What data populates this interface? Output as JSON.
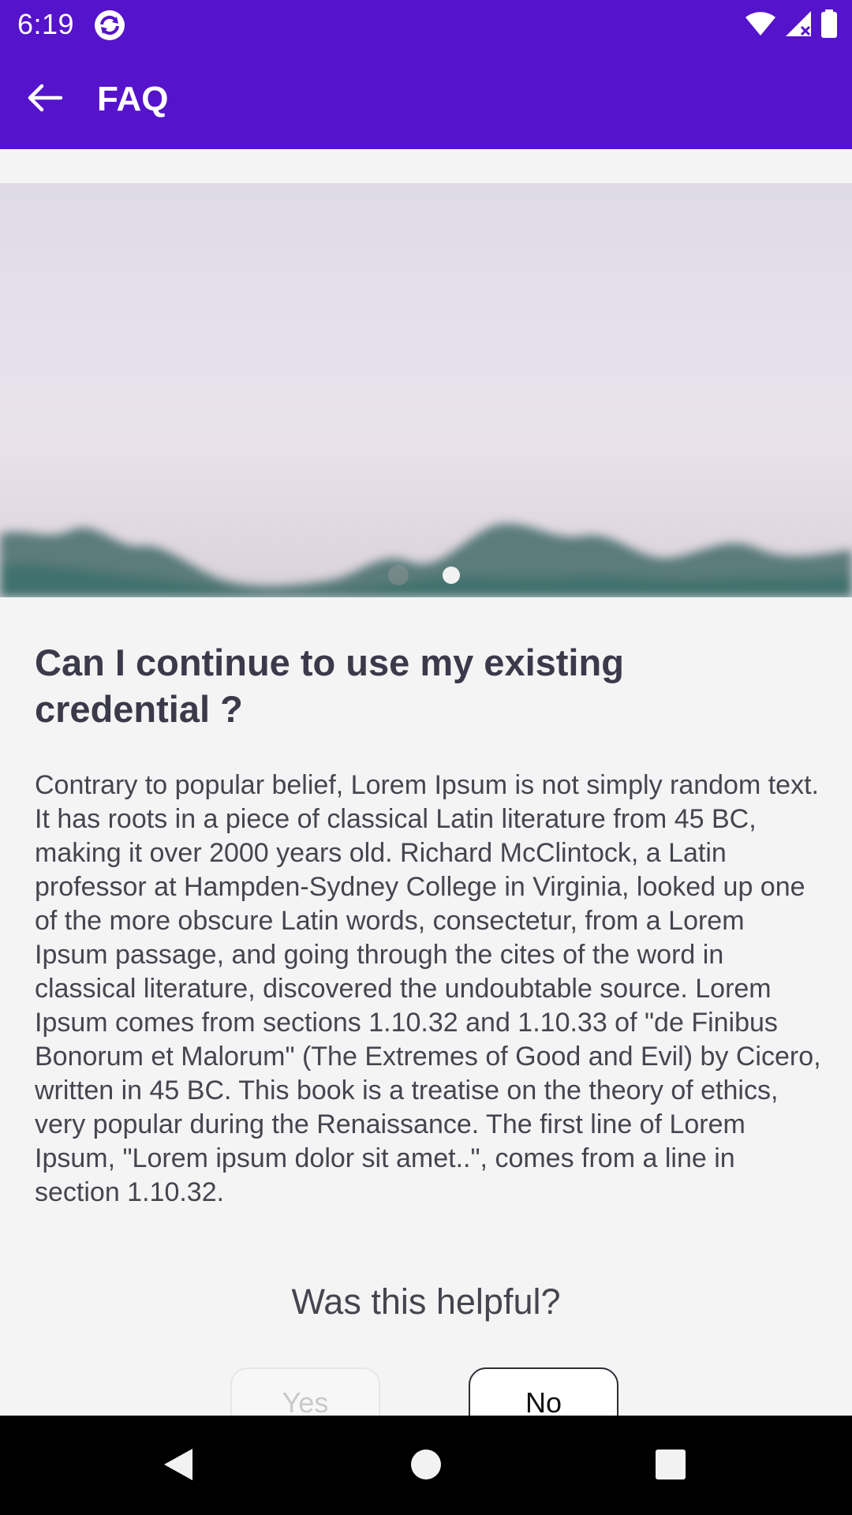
{
  "status_bar": {
    "time": "6:19",
    "app_icon": "sync-icon",
    "icons": [
      "wifi-icon",
      "cellular-signal-icon",
      "battery-icon"
    ]
  },
  "app_bar": {
    "title": "FAQ",
    "back_icon": "arrow-left-icon",
    "background_color": "#5513cc"
  },
  "carousel": {
    "page_count": 2,
    "current_page": 2
  },
  "faq": {
    "question": "Can I continue to use my existing credential ?",
    "answer": "Contrary to popular belief, Lorem Ipsum is not simply random text. It has roots in a piece of classical Latin literature from 45 BC, making it over 2000 years old. Richard McClintock, a Latin professor at Hampden-Sydney College in Virginia, looked up one of the more obscure Latin words, consectetur, from a Lorem Ipsum passage, and going through the cites of the word in classical literature, discovered the undoubtable source. Lorem Ipsum comes from sections 1.10.32 and 1.10.33 of \"de Finibus Bonorum et Malorum\" (The Extremes of Good and Evil) by Cicero, written in 45 BC. This book is a treatise on the theory of ethics, very popular during the Renaissance. The first line of Lorem Ipsum, \"Lorem ipsum dolor sit amet..\", comes from a line in section 1.10.32."
  },
  "feedback": {
    "question": "Was this helpful?",
    "yes_label": "Yes",
    "no_label": "No"
  },
  "nav_bar": {
    "icons": [
      "back-triangle-icon",
      "home-circle-icon",
      "recents-square-icon"
    ]
  }
}
